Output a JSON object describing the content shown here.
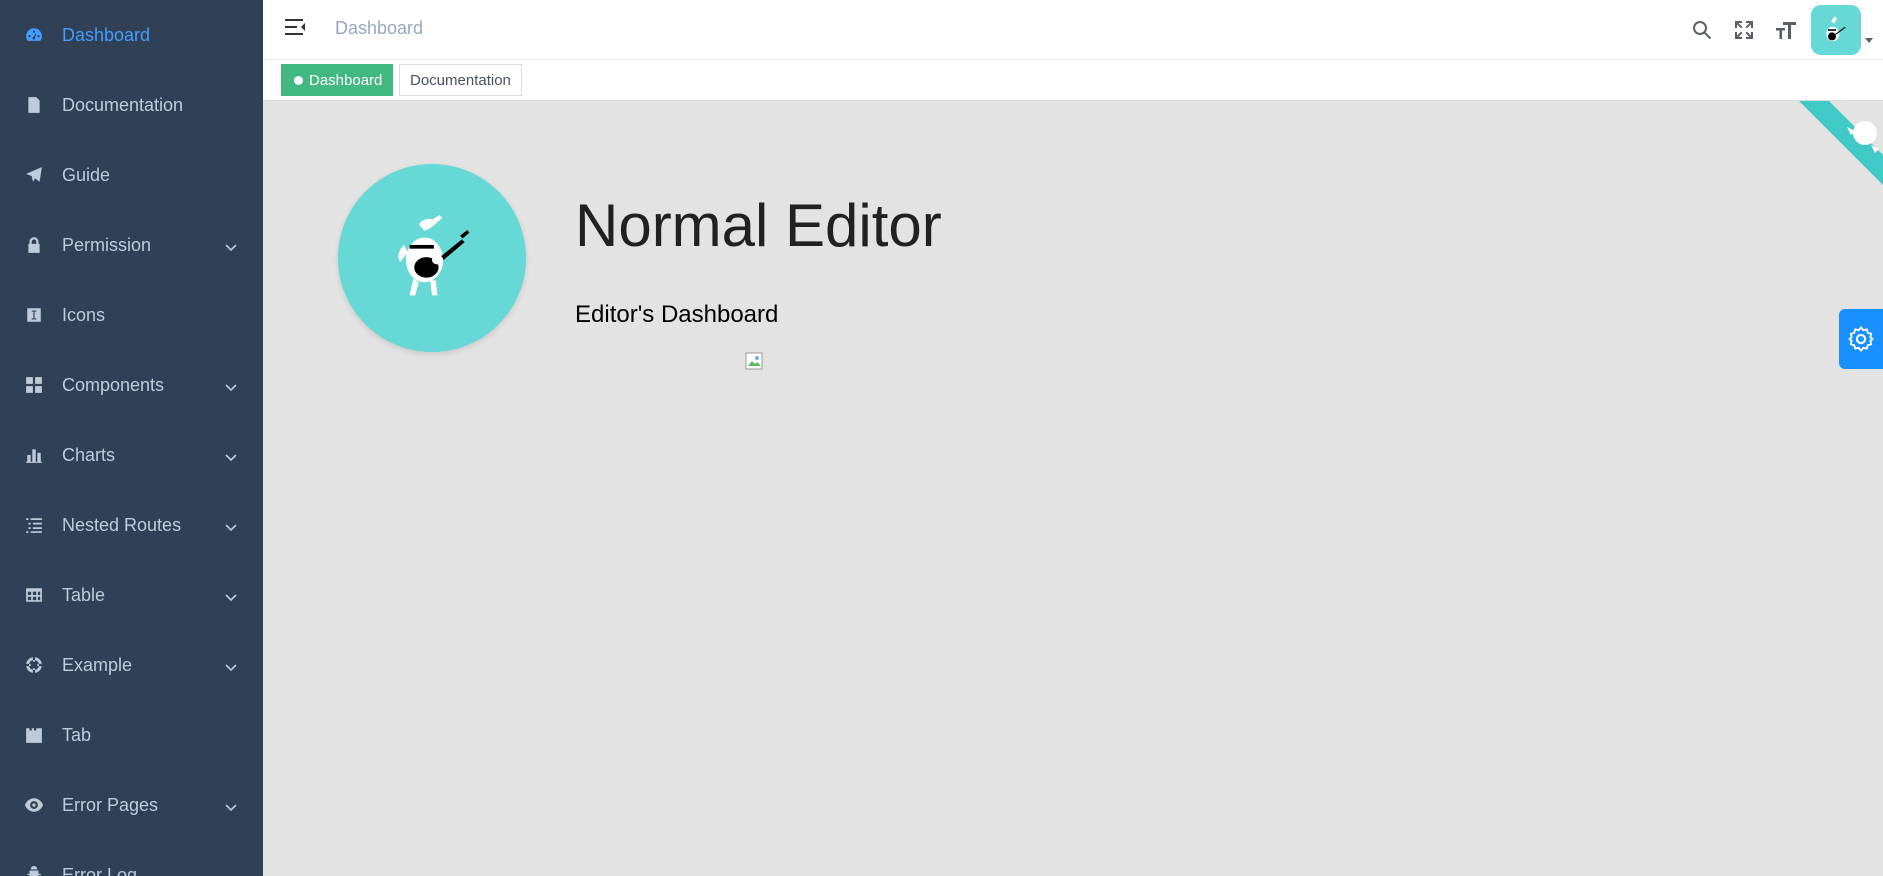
{
  "sidebar": {
    "items": [
      {
        "label": "Dashboard",
        "icon": "dashboard-icon",
        "active": true,
        "has_children": false
      },
      {
        "label": "Documentation",
        "icon": "documentation-icon",
        "active": false,
        "has_children": false
      },
      {
        "label": "Guide",
        "icon": "guide-icon",
        "active": false,
        "has_children": false
      },
      {
        "label": "Permission",
        "icon": "lock-icon",
        "active": false,
        "has_children": true
      },
      {
        "label": "Icons",
        "icon": "icons-icon",
        "active": false,
        "has_children": false
      },
      {
        "label": "Components",
        "icon": "component-icon",
        "active": false,
        "has_children": true
      },
      {
        "label": "Charts",
        "icon": "chart-icon",
        "active": false,
        "has_children": true
      },
      {
        "label": "Nested Routes",
        "icon": "nested-icon",
        "active": false,
        "has_children": true
      },
      {
        "label": "Table",
        "icon": "table-icon",
        "active": false,
        "has_children": true
      },
      {
        "label": "Example",
        "icon": "example-icon",
        "active": false,
        "has_children": true
      },
      {
        "label": "Tab",
        "icon": "tab-icon",
        "active": false,
        "has_children": false
      },
      {
        "label": "Error Pages",
        "icon": "404-icon",
        "active": false,
        "has_children": true
      },
      {
        "label": "Error Log",
        "icon": "bug-icon",
        "active": false,
        "has_children": false
      }
    ]
  },
  "navbar": {
    "breadcrumb": "Dashboard",
    "icons": [
      "search-icon",
      "fullscreen-icon",
      "size-icon"
    ]
  },
  "tags": [
    {
      "label": "Dashboard",
      "active": true
    },
    {
      "label": "Documentation",
      "active": false
    }
  ],
  "main": {
    "role_title": "Normal Editor",
    "subtitle": "Editor's Dashboard"
  },
  "colors": {
    "sidebar_bg": "#304156",
    "sidebar_text": "#bfcbd9",
    "active_text": "#409eff",
    "tag_active": "#42b983",
    "avatar_bg": "#66d9d6",
    "settings_btn": "#1890ff",
    "main_bg": "#e3e3e3"
  }
}
